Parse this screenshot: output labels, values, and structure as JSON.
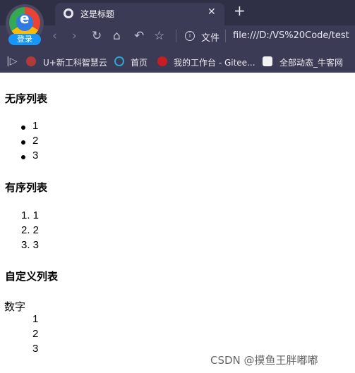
{
  "browser": {
    "tab_title": "这是标题",
    "tab_close": "✕",
    "new_tab": "+",
    "profile_login": "登录",
    "scheme_label": "文件",
    "url": "file:///D:/VS%20Code/test",
    "nav": {
      "back": "‹",
      "forward": "›",
      "reload": "↻",
      "home": "⌂",
      "undo": "↶",
      "star": "☆"
    },
    "bookmarks": [
      {
        "label": "U+新工科智慧云",
        "icon": "red-gear-icon",
        "color": "#c0392b"
      },
      {
        "label": "首页",
        "icon": "spiral-icon",
        "color": "#2fa4d7"
      },
      {
        "label": "我的工作台 - Gitee...",
        "icon": "gitee-icon",
        "color": "#c71d23"
      },
      {
        "label": "全部动态_牛客网",
        "icon": "nowcoder-icon",
        "color": "#f2f2f2"
      }
    ]
  },
  "page": {
    "unordered_heading": "无序列表",
    "unordered_items": [
      "1",
      "2",
      "3"
    ],
    "ordered_heading": "有序列表",
    "ordered_items": [
      "1. 1",
      "2. 2",
      "3. 3"
    ],
    "definition_heading": "自定义列表",
    "definition_term": "数字",
    "definition_items": [
      "1",
      "2",
      "3"
    ]
  },
  "watermark": "CSDN @摸鱼王胖嘟嘟"
}
